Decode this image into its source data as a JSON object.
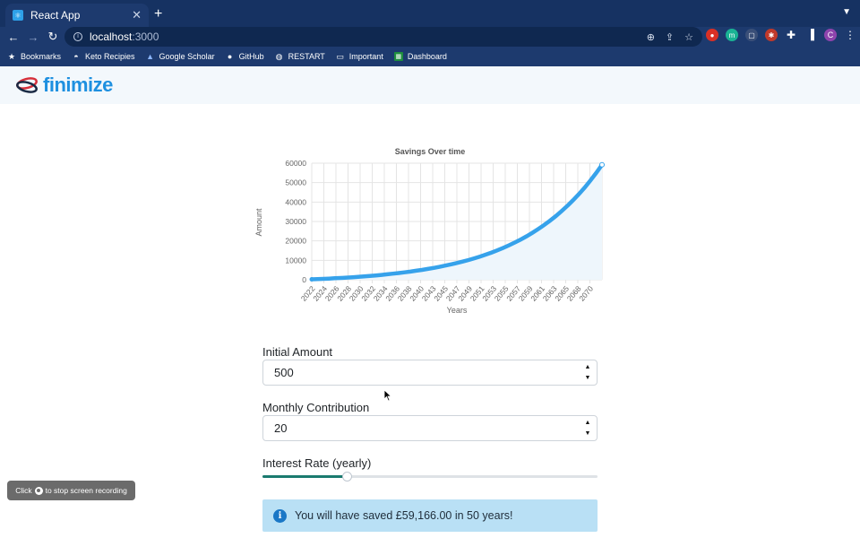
{
  "browser": {
    "tab_title": "React App",
    "url_host": "localhost",
    "url_port": ":3000",
    "new_tab_symbol": "+",
    "bookmarks": [
      {
        "label": "Bookmarks",
        "icon": "star-icon"
      },
      {
        "label": "Keto Recipies",
        "icon": "bowl-icon"
      },
      {
        "label": "Google Scholar",
        "icon": "scholar-icon"
      },
      {
        "label": "GitHub",
        "icon": "github-icon"
      },
      {
        "label": "RESTART",
        "icon": "globe-icon"
      },
      {
        "label": "Important",
        "icon": "folder-icon"
      },
      {
        "label": "Dashboard",
        "icon": "sheets-icon"
      }
    ],
    "profile_initial": "C"
  },
  "app": {
    "logo_text": "finimize",
    "brand_color": "#1e90e0"
  },
  "chart_data": {
    "type": "area",
    "title": "Savings Over time",
    "xlabel": "Years",
    "ylabel": "Amount",
    "ylim": [
      0,
      60000
    ],
    "yticks": [
      0,
      10000,
      20000,
      30000,
      40000,
      50000,
      60000
    ],
    "xticks": [
      "2022",
      "2024",
      "2026",
      "2028",
      "2030",
      "2032",
      "2034",
      "2036",
      "2038",
      "2040",
      "2043",
      "2045",
      "2047",
      "2049",
      "2051",
      "2053",
      "2055",
      "2057",
      "2059",
      "2061",
      "2063",
      "2065",
      "2068",
      "2070"
    ],
    "x_start": 2022,
    "x_end": 2072,
    "series": [
      {
        "color": "#36a2eb",
        "fill": "#eef6fc",
        "initial": 500,
        "monthly": 20,
        "annual_rate": 0.072,
        "final_value": 59166
      }
    ],
    "grid": true
  },
  "form": {
    "initial_label": "Initial Amount",
    "initial_value": "500",
    "monthly_label": "Monthly Contribution",
    "monthly_value": "20",
    "rate_label": "Interest Rate (yearly)",
    "rate_fraction": 0.25
  },
  "result": {
    "message": "You will have saved £59,166.00 in 50 years!",
    "icon": "info-icon"
  },
  "recording_toast": {
    "prefix": "Click",
    "suffix": "to stop screen recording"
  }
}
